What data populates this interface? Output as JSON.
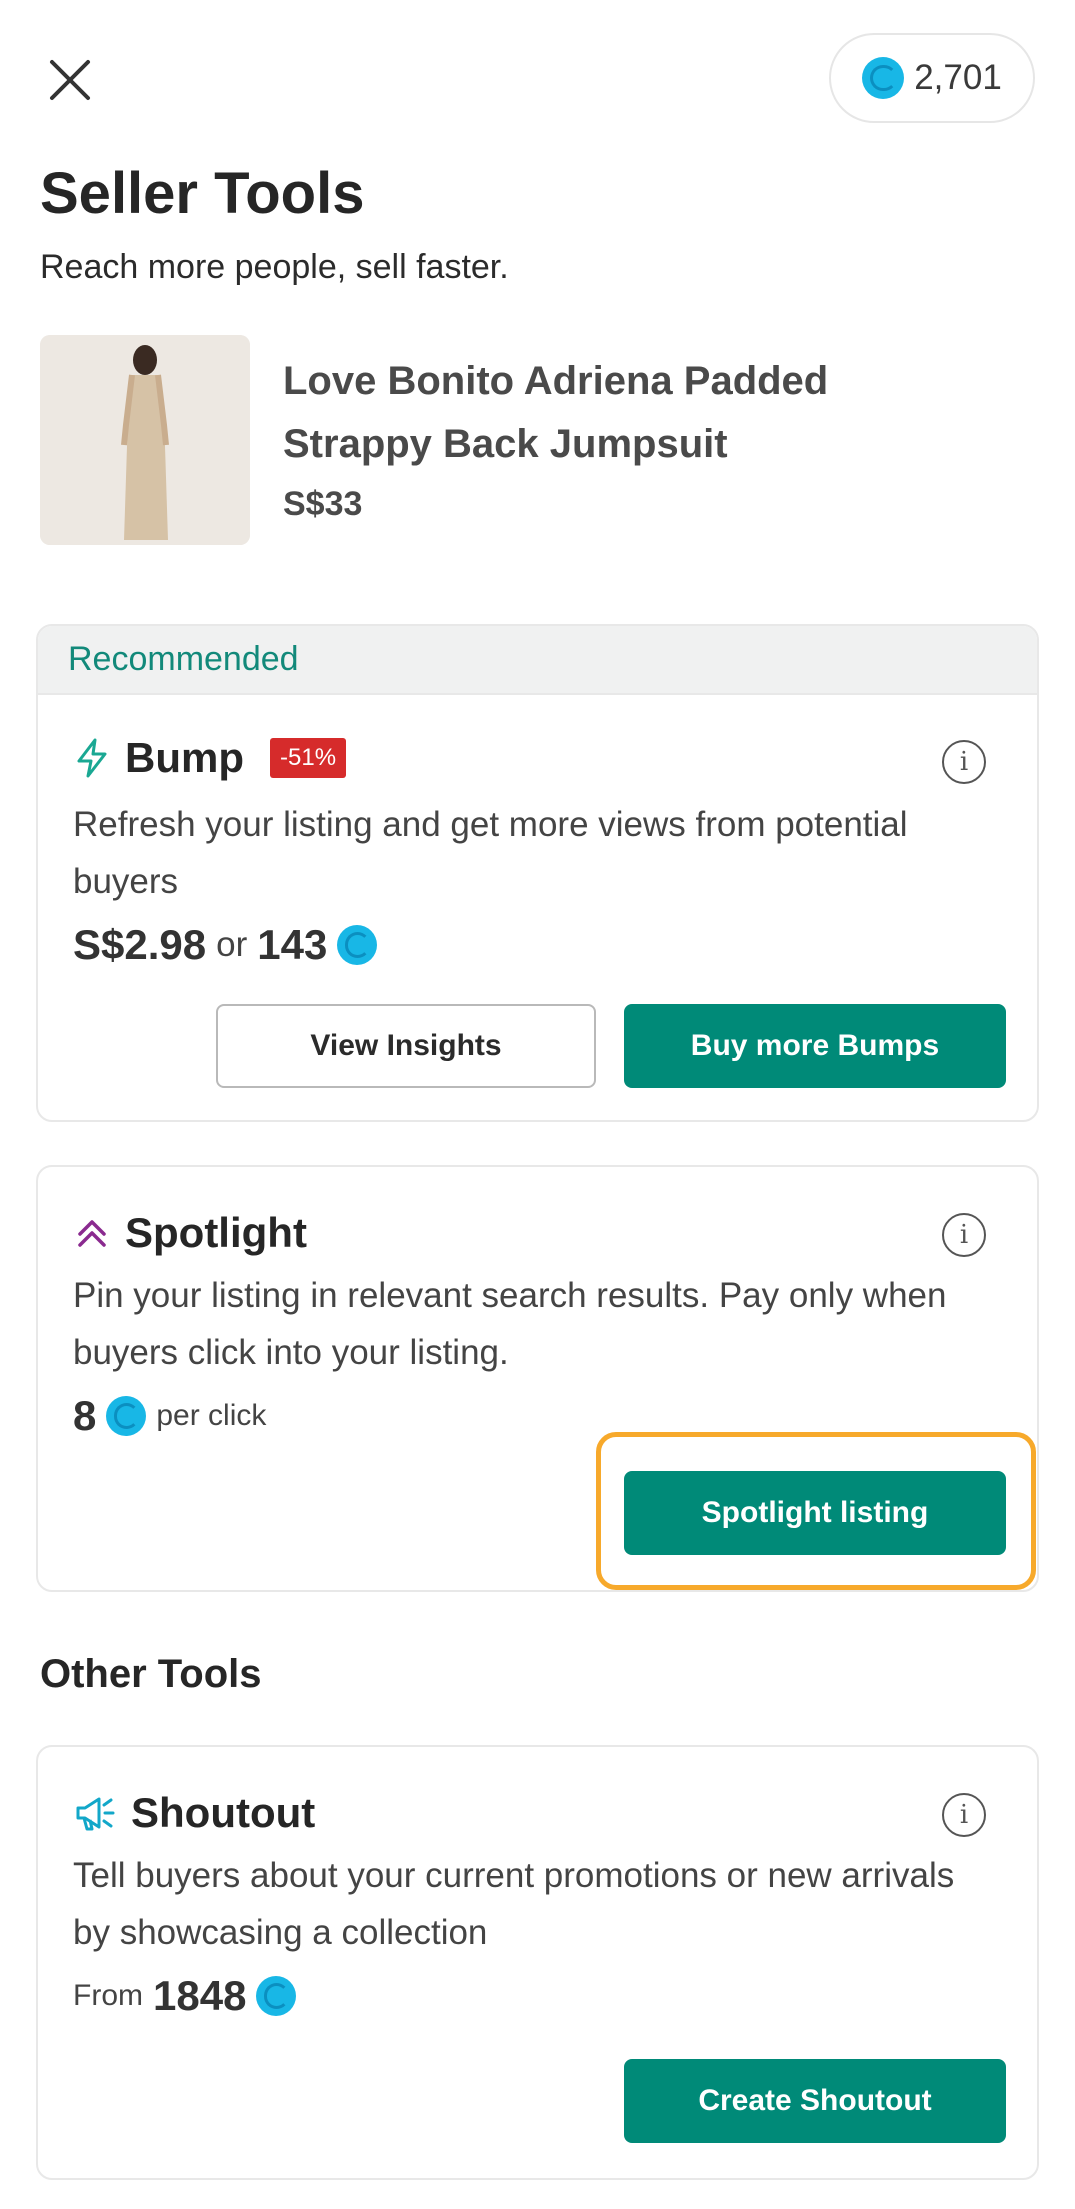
{
  "header": {
    "close_icon": "close-icon",
    "coin_balance": "2,701",
    "coin_color": "#18b7e6"
  },
  "title": "Seller Tools",
  "subtitle": "Reach more people, sell faster.",
  "product": {
    "name": "Love Bonito Adriena Padded Strappy Back  Jumpsuit",
    "price": "S$33"
  },
  "recommended": {
    "section_label": "Recommended",
    "bump": {
      "icon": "lightning-icon",
      "name": "Bump",
      "discount": "-51%",
      "description": "Refresh your listing and get more views from potential buyers",
      "price": "S$2.98",
      "or_label": "or",
      "coin_price": "143",
      "view_insights_label": "View Insights",
      "buy_more_label": "Buy more Bumps"
    }
  },
  "spotlight": {
    "icon": "double-chevron-up-icon",
    "name": "Spotlight",
    "description": "Pin your listing in relevant search results. Pay only when buyers click into your listing.",
    "coin_price": "8",
    "per_click_label": "per click",
    "button_label": "Spotlight listing"
  },
  "other_tools": {
    "title": "Other Tools",
    "shoutout": {
      "icon": "megaphone-icon",
      "name": "Shoutout",
      "description": "Tell buyers about your current promotions or new arrivals by showcasing a collection",
      "from_label": "From",
      "coin_price": "1848",
      "button_label": "Create Shoutout"
    }
  },
  "colors": {
    "brand_green": "#008a78",
    "highlight_orange": "#f7a92b",
    "discount_red": "#d62b2b"
  }
}
